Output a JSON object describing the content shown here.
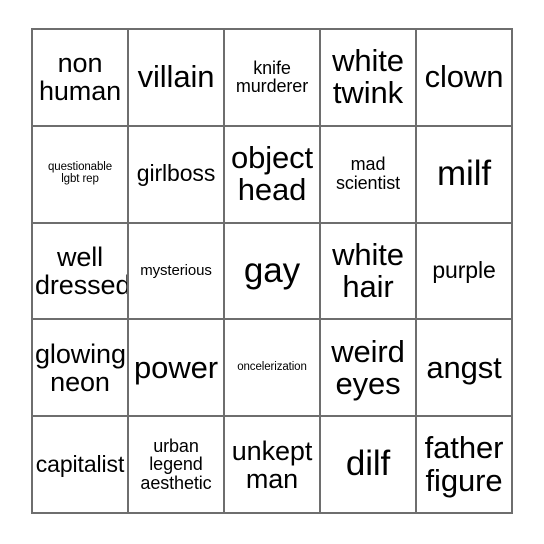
{
  "card": {
    "type": "bingo-card",
    "rows": 5,
    "columns": 5,
    "border_color": "#6e6e6e",
    "cell_background": "#ffffff",
    "text_color": "#000000",
    "cells": [
      {
        "text": "non\nhuman",
        "size": "l"
      },
      {
        "text": "villain",
        "size": "xl"
      },
      {
        "text": "knife\nmurderer",
        "size": "s"
      },
      {
        "text": "white\ntwink",
        "size": "xl"
      },
      {
        "text": "clown",
        "size": "xl"
      },
      {
        "text": "questionable\nlgbt rep",
        "size": "xxs"
      },
      {
        "text": "girlboss",
        "size": "m"
      },
      {
        "text": "object\nhead",
        "size": "xl"
      },
      {
        "text": "mad\nscientist",
        "size": "s"
      },
      {
        "text": "milf",
        "size": "xxl"
      },
      {
        "text": "well\ndressed",
        "size": "l"
      },
      {
        "text": "mysterious",
        "size": "xs"
      },
      {
        "text": "gay",
        "size": "xxl"
      },
      {
        "text": "white\nhair",
        "size": "xl"
      },
      {
        "text": "purple",
        "size": "m"
      },
      {
        "text": "glowing\nneon",
        "size": "l"
      },
      {
        "text": "power",
        "size": "xl"
      },
      {
        "text": "oncelerization",
        "size": "xxs"
      },
      {
        "text": "weird\neyes",
        "size": "xl"
      },
      {
        "text": "angst",
        "size": "xl"
      },
      {
        "text": "capitalist",
        "size": "m"
      },
      {
        "text": "urban\nlegend\naesthetic",
        "size": "s"
      },
      {
        "text": "unkept\nman",
        "size": "l"
      },
      {
        "text": "dilf",
        "size": "xxl"
      },
      {
        "text": "father\nfigure",
        "size": "xl"
      }
    ]
  }
}
